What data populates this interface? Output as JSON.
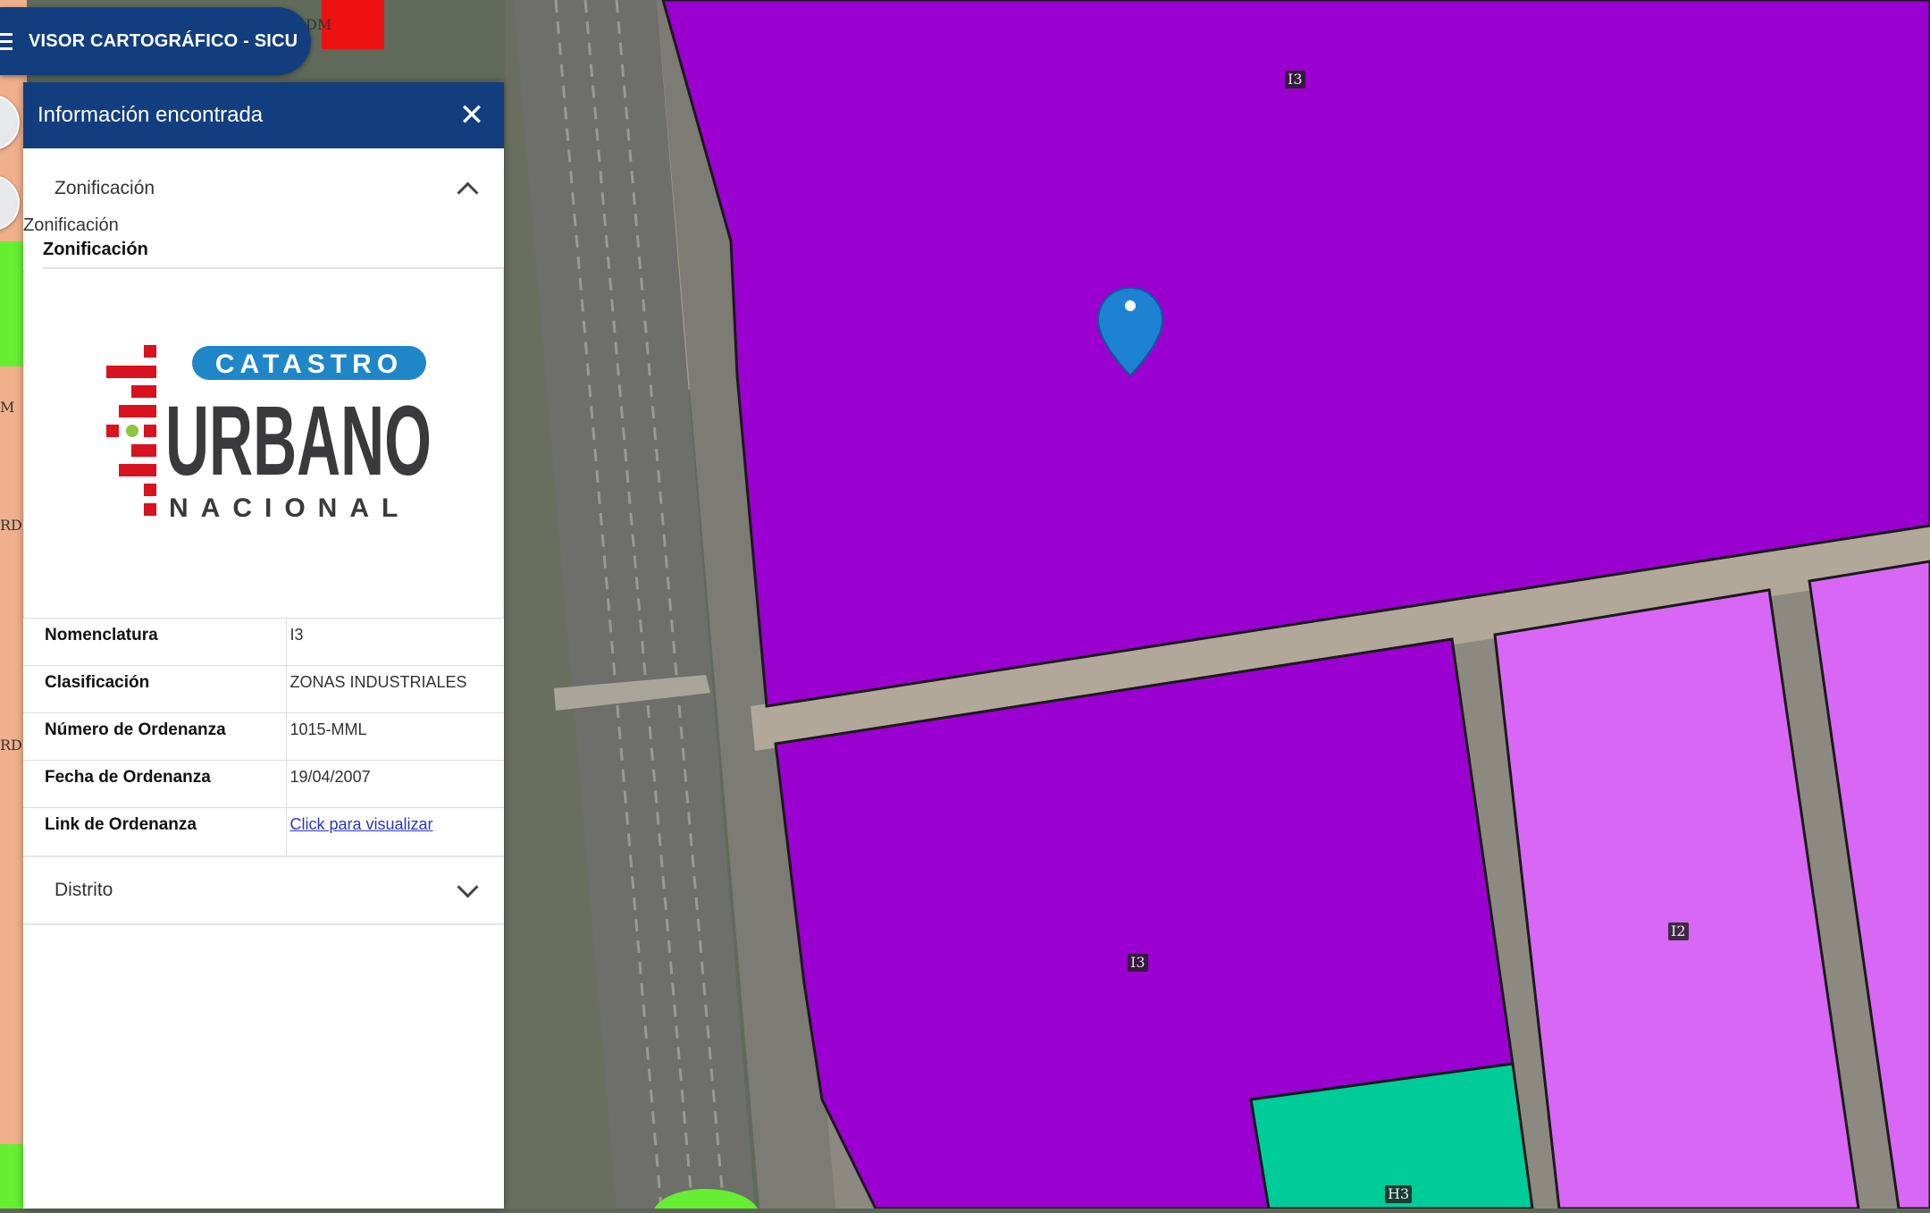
{
  "app": {
    "title": "VISOR CARTOGRÁFICO - SICU"
  },
  "panel": {
    "title": "Información encontrada",
    "close_symbol": "✕",
    "section1": {
      "header": "Zonificación",
      "sublabel": "Zonificación",
      "sublabel_bold": "Zonificación"
    },
    "logo": {
      "top_word": "CATASTRO",
      "main_word": "URBANO",
      "bottom_word": "NACIONAL",
      "colors": {
        "blue": "#1f86c8",
        "red": "#d8121f",
        "dark": "#3a3a3c",
        "green": "#8dc63f"
      }
    },
    "attributes": [
      {
        "key": "Nomenclatura",
        "value": "I3"
      },
      {
        "key": "Clasificación",
        "value": "ZONAS INDUSTRIALES"
      },
      {
        "key": "Número de Ordenanza",
        "value": "1015-MML"
      },
      {
        "key": "Fecha de Ordenanza",
        "value": "19/04/2007"
      },
      {
        "key": "Link de Ordenanza",
        "value": "Click para visualizar"
      }
    ],
    "section2": {
      "header": "Distrito"
    }
  },
  "map": {
    "zones": [
      {
        "code": "I3",
        "color": "#9a00d0"
      },
      {
        "code": "I3",
        "color": "#9a00d0"
      },
      {
        "code": "I2",
        "color": "#d867f5"
      },
      {
        "code": "H3",
        "color": "#00cc99"
      }
    ],
    "edge_labels": [
      "DM",
      "M",
      "RDM",
      "RDM"
    ],
    "colors": {
      "highway": "#6e6e6a",
      "sidewalk": "#b2a89a",
      "marker": "#1e82d2",
      "park": "#66ee33",
      "residential": "#f0b08c",
      "commercial": "#ee1111"
    }
  }
}
